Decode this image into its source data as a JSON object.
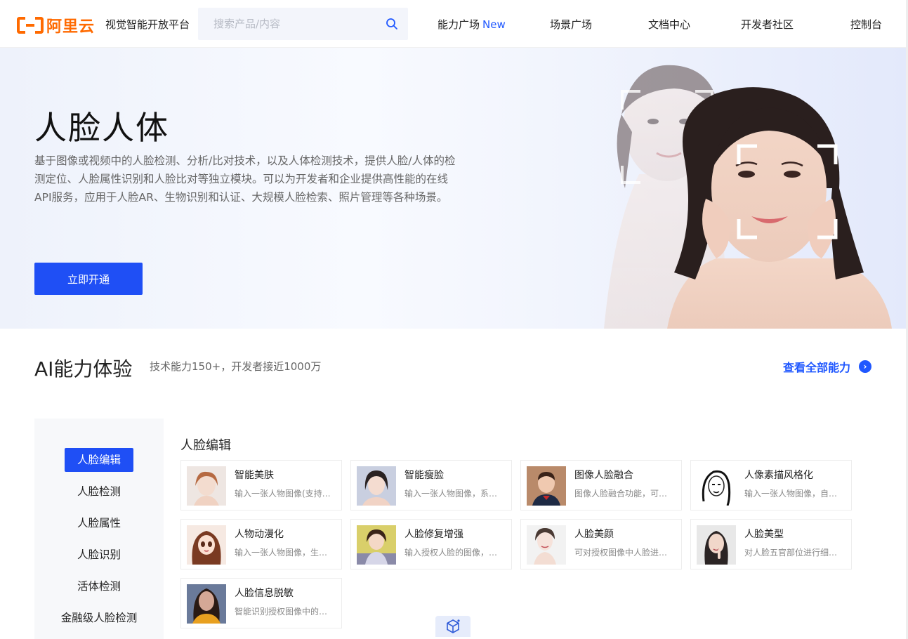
{
  "header": {
    "logo_text": "阿里云",
    "platform": "视觉智能开放平台",
    "search_placeholder": "搜索产品/内容",
    "nav": [
      {
        "label": "能力广场",
        "badge": "New"
      },
      {
        "label": "场景广场"
      },
      {
        "label": "文档中心"
      },
      {
        "label": "开发者社区"
      },
      {
        "label": "控制台"
      }
    ]
  },
  "hero": {
    "title": "人脸人体",
    "description": "基于图像或视频中的人脸检测、分析/比对技术，以及人体检测技术，提供人脸/人体的检测定位、人脸属性识别和人脸比对等独立模块。可以为开发者和企业提供高性能的在线API服务，应用于人脸AR、生物识别和认证、大规模人脸检索、照片管理等各种场景。",
    "cta": "立即开通"
  },
  "ai": {
    "title": "AI能力体验",
    "subtitle": "技术能力150+，开发者接近1000万",
    "view_all": "查看全部能力"
  },
  "sidebar": {
    "items": [
      "人脸编辑",
      "人脸检测",
      "人脸属性",
      "人脸识别",
      "活体检测",
      "金融级人脸检测"
    ],
    "active_index": 0
  },
  "section": {
    "title": "人脸编辑",
    "cards": [
      {
        "name": "智能美肤",
        "desc": "输入一张人物图像(支持…"
      },
      {
        "name": "智能瘦脸",
        "desc": "输入一张人物图像，系…"
      },
      {
        "name": "图像人脸融合",
        "desc": "图像人脸融合功能，可…"
      },
      {
        "name": "人像素描风格化",
        "desc": "输入一张人物图像，自…"
      },
      {
        "name": "人物动漫化",
        "desc": "输入一张人物图像，生…"
      },
      {
        "name": "人脸修复增强",
        "desc": "输入授权人脸的图像，…"
      },
      {
        "name": "人脸美颜",
        "desc": "可对授权图像中人脸进…"
      },
      {
        "name": "人脸美型",
        "desc": "对人脸五官部位进行细…"
      },
      {
        "name": "人脸信息脱敏",
        "desc": "智能识别授权图像中的…"
      }
    ]
  },
  "colors": {
    "brand": "#ff6a00",
    "primary": "#1f4ff5",
    "link": "#1f57ff"
  }
}
